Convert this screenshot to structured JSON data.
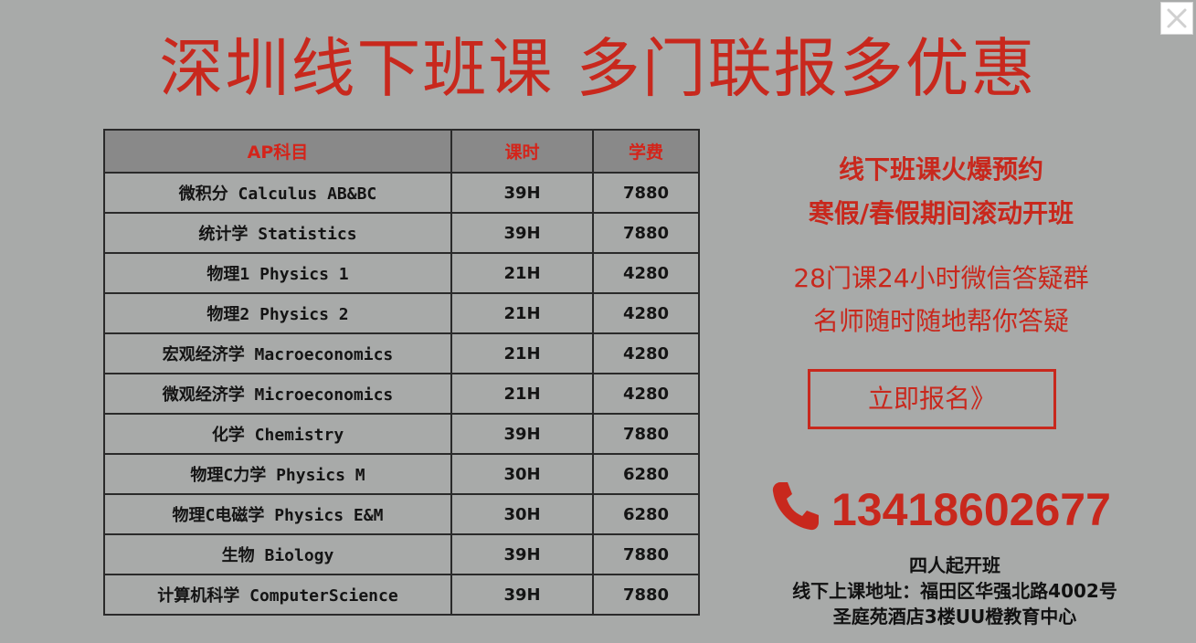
{
  "headline": "深圳线下班课 多门联报多优惠",
  "close_icon": "close-icon",
  "table": {
    "headers": [
      "AP科目",
      "课时",
      "学费"
    ],
    "rows": [
      {
        "subject": "微积分 Calculus AB&BC",
        "hours": "39H",
        "fee": "7880"
      },
      {
        "subject": "统计学 Statistics",
        "hours": "39H",
        "fee": "7880"
      },
      {
        "subject": "物理1 Physics 1",
        "hours": "21H",
        "fee": "4280"
      },
      {
        "subject": "物理2 Physics 2",
        "hours": "21H",
        "fee": "4280"
      },
      {
        "subject": "宏观经济学 Macroeconomics",
        "hours": "21H",
        "fee": "4280"
      },
      {
        "subject": "微观经济学 Microeconomics",
        "hours": "21H",
        "fee": "4280"
      },
      {
        "subject": "化学 Chemistry",
        "hours": "39H",
        "fee": "7880"
      },
      {
        "subject": "物理C力学 Physics M",
        "hours": "30H",
        "fee": "6280"
      },
      {
        "subject": "物理C电磁学 Physics E&M",
        "hours": "30H",
        "fee": "6280"
      },
      {
        "subject": "生物 Biology",
        "hours": "39H",
        "fee": "7880"
      },
      {
        "subject": "计算机科学 ComputerScience",
        "hours": "39H",
        "fee": "7880"
      }
    ]
  },
  "promo": {
    "line1": "线下班课火爆预约",
    "line2": "寒假/春假期间滚动开班",
    "support_line1": "28门课24小时微信答疑群",
    "support_line2": "名师随时随地帮你答疑",
    "signup_label": "立即报名》"
  },
  "contact": {
    "phone_icon": "phone-icon",
    "phone": "13418602677",
    "min_class": "四人起开班",
    "address_line1": "线下上课地址：福田区华强北路4002号",
    "address_line2": "圣庭苑酒店3楼UU橙教育中心"
  },
  "colors": {
    "background": "#a8aaa9",
    "accent_red": "#c8281d",
    "header_gray": "#898989"
  }
}
